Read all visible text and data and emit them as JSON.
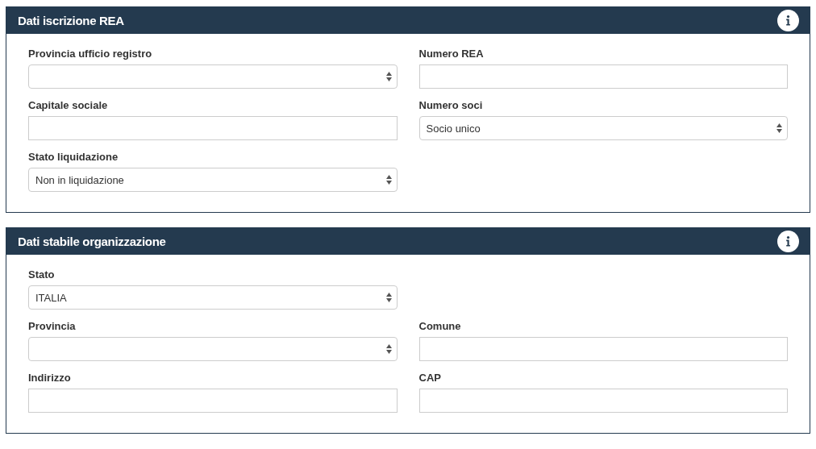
{
  "panels": [
    {
      "title": "Dati iscrizione REA",
      "rows": [
        [
          {
            "label": "Provincia ufficio registro",
            "kind": "select"
          },
          {
            "label": "Numero REA",
            "kind": "text"
          }
        ],
        [
          {
            "label": "Capitale sociale",
            "kind": "text"
          },
          {
            "label": "Numero soci",
            "kind": "select",
            "value": "Socio unico"
          }
        ],
        [
          {
            "label": "Stato liquidazione",
            "kind": "select",
            "value": "Non in liquidazione"
          }
        ]
      ]
    },
    {
      "title": "Dati stabile organizzazione",
      "rows": [
        [
          {
            "label": "Stato",
            "kind": "select",
            "value": "ITALIA"
          }
        ],
        [
          {
            "label": "Provincia",
            "kind": "select"
          },
          {
            "label": "Comune",
            "kind": "text"
          }
        ],
        [
          {
            "label": "Indirizzo",
            "kind": "text"
          },
          {
            "label": "CAP",
            "kind": "text"
          }
        ]
      ]
    }
  ]
}
